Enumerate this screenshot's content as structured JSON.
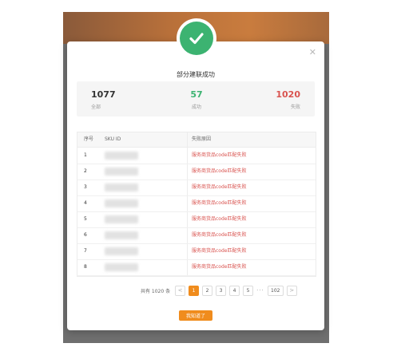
{
  "dialog": {
    "title": "部分建联成功",
    "close_icon": "close-icon",
    "success_icon": "checkmark-icon",
    "ok_label": "我知道了"
  },
  "stats": {
    "total": {
      "value": "1077",
      "label": "全部"
    },
    "success": {
      "value": "57",
      "label": "成功"
    },
    "fail": {
      "value": "1020",
      "label": "失败"
    }
  },
  "table": {
    "headers": {
      "index": "序号",
      "sku": "SKU ID",
      "reason": "失败原因"
    },
    "rows": [
      {
        "index": "1",
        "reason": "服务商货品code匹配失败"
      },
      {
        "index": "2",
        "reason": "服务商货品code匹配失败"
      },
      {
        "index": "3",
        "reason": "服务商货品code匹配失败"
      },
      {
        "index": "4",
        "reason": "服务商货品code匹配失败"
      },
      {
        "index": "5",
        "reason": "服务商货品code匹配失败"
      },
      {
        "index": "6",
        "reason": "服务商货品code匹配失败"
      },
      {
        "index": "7",
        "reason": "服务商货品code匹配失败"
      },
      {
        "index": "8",
        "reason": "服务商货品code匹配失败"
      }
    ]
  },
  "pagination": {
    "total_text": "共有 1020 条",
    "prev_icon": "chevron-left-icon",
    "next_icon": "chevron-right-icon",
    "pages": [
      "1",
      "2",
      "3",
      "4",
      "5"
    ],
    "current": "1",
    "ellipsis": "···",
    "last_page": "102"
  },
  "colors": {
    "accent": "#f08c1d",
    "success": "#3cb371",
    "fail": "#d9534f"
  }
}
